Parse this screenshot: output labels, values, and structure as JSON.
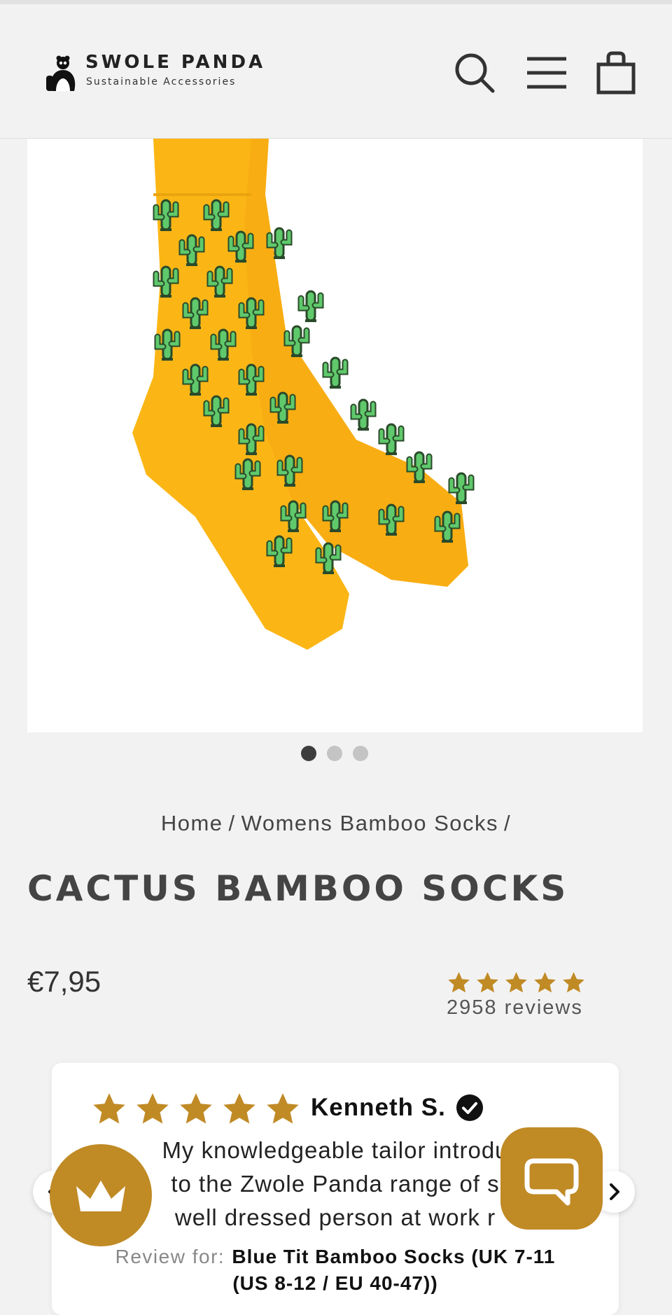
{
  "brand": {
    "name": "SWOLE PANDA",
    "tagline": "Sustainable Accessories"
  },
  "header_icons": [
    "search-icon",
    "menu-icon",
    "cart-icon"
  ],
  "gallery": {
    "image_alt": "Yellow socks with green cactus pattern",
    "slide_count": 3,
    "active_slide": 1
  },
  "breadcrumb": {
    "home": "Home",
    "separator": "/",
    "category": "Womens Bamboo Socks"
  },
  "product": {
    "title": "CACTUS BAMBOO SOCKS",
    "price": "€7,95",
    "rating": 5,
    "review_count_text": "2958 reviews"
  },
  "review": {
    "rating": 5,
    "author": "Kenneth S.",
    "verified": true,
    "text_lines": [
      "My knowledgeable tailor introdu",
      "to the Zwole Panda range of s",
      "well dressed person at work r"
    ],
    "for_label": "Review for:",
    "for_product_line1": "Blue Tit Bamboo Socks (UK 7-11",
    "for_product_line2": "(US 8-12 / EU 40-47))"
  },
  "colors": {
    "accent": "#c08a25",
    "star": "#c08a25",
    "sock_yellow": "#fbb616",
    "cactus_green": "#5fc96b",
    "text_dark": "#444444"
  }
}
